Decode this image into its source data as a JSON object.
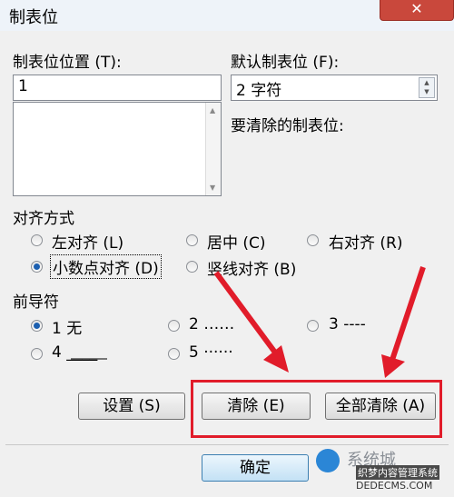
{
  "window": {
    "title": "制表位",
    "close": "✕"
  },
  "tab_position": {
    "label": "制表位位置 (T):",
    "value": "1"
  },
  "default_tab": {
    "label": "默认制表位 (F):",
    "value": "2 字符"
  },
  "clear_label": "要清除的制表位:",
  "alignment": {
    "label": "对齐方式",
    "options": [
      "左对齐 (L)",
      "居中 (C)",
      "右对齐 (R)",
      "小数点对齐 (D)",
      "竖线对齐 (B)"
    ],
    "selected": "小数点对齐 (D)"
  },
  "leader": {
    "label": "前导符",
    "options": [
      "1 无",
      "2 ……",
      "3 ----",
      "4 ____",
      "5 ······"
    ],
    "selected": "1 无"
  },
  "buttons": {
    "set": "设置 (S)",
    "clear": "清除 (E)",
    "clear_all": "全部清除 (A)",
    "ok": "确定"
  },
  "watermark": {
    "text1": "系统城",
    "text2": "织梦内容管理系统",
    "text3": "DEDECMS.COM"
  },
  "colors": {
    "highlight": "#e11c2a",
    "radio_selected": "#1c5fb0"
  }
}
